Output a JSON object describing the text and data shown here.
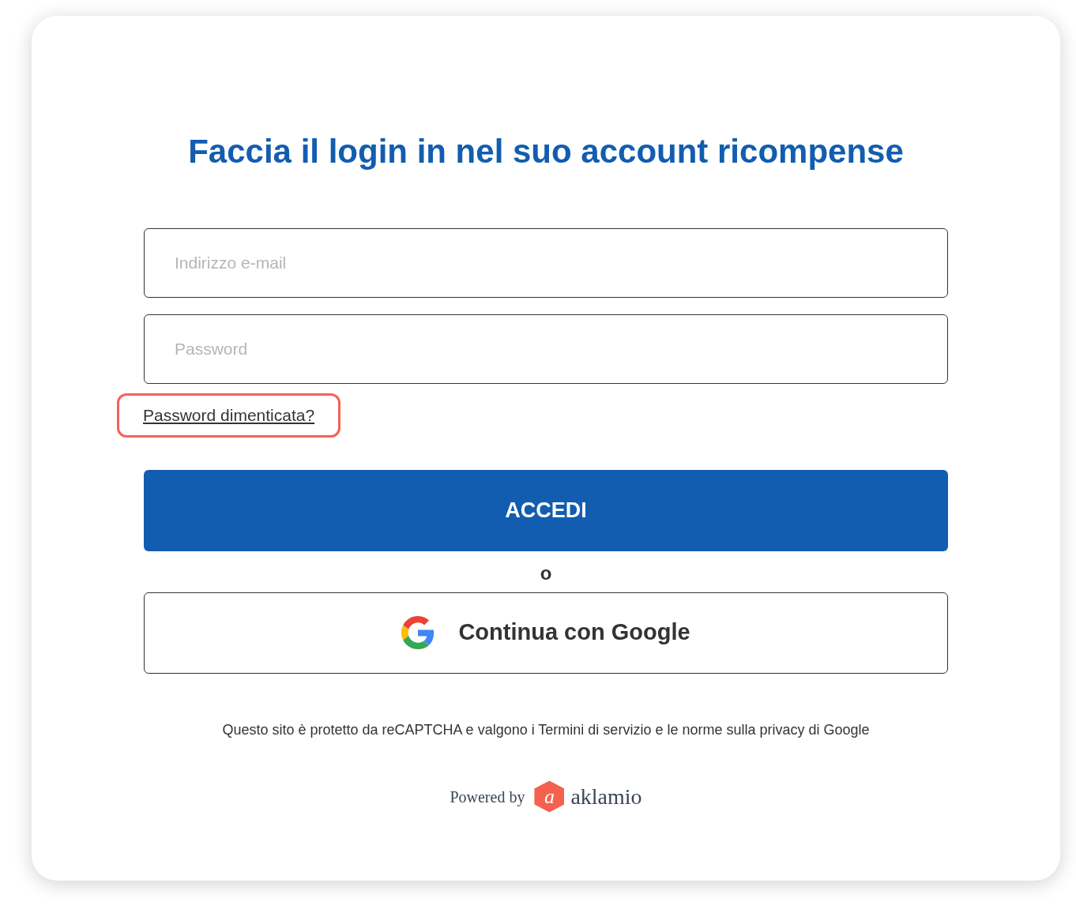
{
  "title": "Faccia il login in nel suo account ricompense",
  "fields": [
    {
      "placeholder": "Indirizzo e-mail"
    },
    {
      "placeholder": "Password"
    }
  ],
  "forgot_link": {
    "label": "Password dimenticata?",
    "highlighted": true
  },
  "submit_button": "ACCEDI",
  "separator": "o",
  "google_button": "Continua con Google",
  "recaptcha_notice": "Questo sito è protetto da reCAPTCHA e valgono i Termini di servizio e le norme sulla privacy di Google",
  "powered_by": {
    "label": "Powered by",
    "logo_mark": "a",
    "logo_name": "aklamio"
  }
}
